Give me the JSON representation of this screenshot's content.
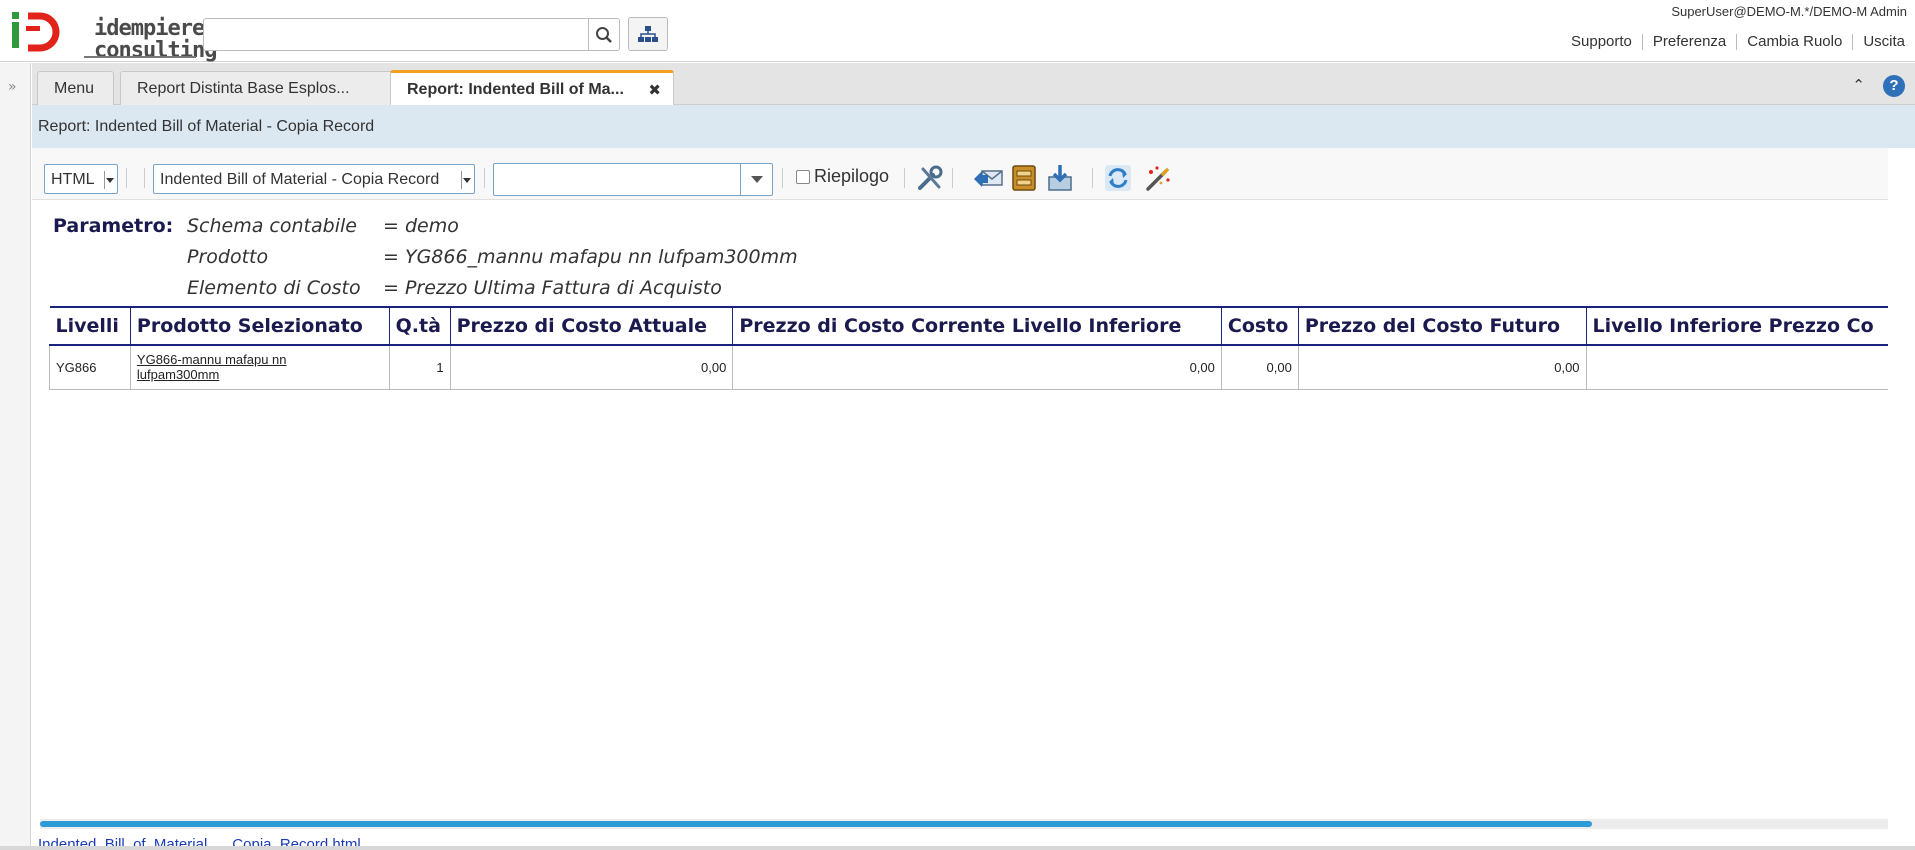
{
  "header": {
    "logo_text_line1": "idempiere",
    "logo_text_line2": "consulting",
    "search_placeholder": "",
    "user": "SuperUser@DEMO-M.*/DEMO-M Admin",
    "links": [
      "Supporto",
      "Preferenza",
      "Cambia Ruolo",
      "Uscita"
    ]
  },
  "tabs": [
    {
      "label": "Menu",
      "closable": false
    },
    {
      "label": "Report Distinta Base Esplos...",
      "closable": true
    },
    {
      "label": "Report: Indented Bill of Ma...",
      "closable": true,
      "active": true
    }
  ],
  "title": "Report: Indented Bill of Material - Copia Record",
  "toolbar": {
    "format": "HTML",
    "print_format": "Indented Bill of Material - Copia Record",
    "find_value": "",
    "summary_label": "Riepilogo",
    "summary_checked": false,
    "icons": [
      "customize-icon",
      "send-email-icon",
      "archive-icon",
      "export-icon",
      "refresh-icon",
      "wizard-icon"
    ]
  },
  "report": {
    "param_heading": "Parametro:",
    "params": [
      {
        "name": "Schema contabile",
        "value": "= demo"
      },
      {
        "name": "Prodotto",
        "value": "= YG866_mannu mafapu nn lufpam300mm"
      },
      {
        "name": "Elemento di Costo",
        "value": "= Prezzo Ultima Fattura di Acquisto"
      }
    ],
    "columns": [
      "Livelli",
      "Prodotto Selezionato",
      "Q.tà",
      "Prezzo di Costo Attuale",
      "Prezzo di Costo Corrente Livello Inferiore",
      "Costo",
      "Prezzo del Costo Futuro",
      "Livello Inferiore Prezzo Co"
    ],
    "rows": [
      {
        "livelli": "YG866",
        "prodotto_line1": "YG866-mannu mafapu nn",
        "prodotto_line2": "lufpam300mm",
        "qta": "1",
        "costo_attuale": "0,00",
        "costo_corrente_inf": "0,00",
        "costo": "0,00",
        "costo_futuro": "0,00",
        "inf_prezzo": ""
      }
    ]
  },
  "footer": {
    "file_link": "Indented_Bill_of_Material___Copia_Record.html",
    "scroll_fraction": 0.84
  },
  "colors": {
    "accent_tab": "#f29e1f",
    "title_strip": "#dbe7f1",
    "table_header": "#1a1a4e",
    "scroll_thumb": "#2e9bd6",
    "logo_red": "#e2231a",
    "logo_green": "#2e9a3c"
  }
}
